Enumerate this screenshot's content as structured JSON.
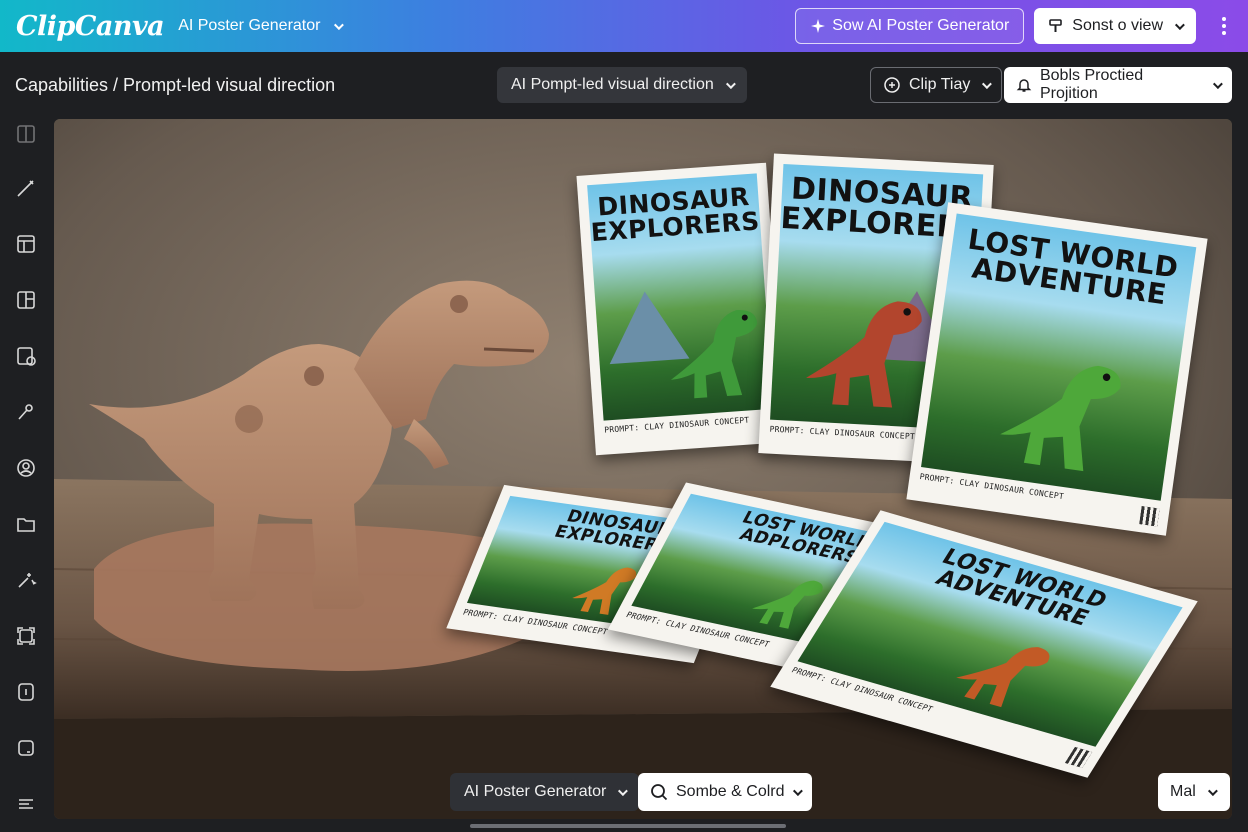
{
  "header": {
    "logo": "ClipCanva",
    "app_menu_label": "AI Poster Generator",
    "primary_button": "Sow AI Poster Generator",
    "view_button": "Sonst o view"
  },
  "subheader": {
    "breadcrumb": "Capabilities / Prompt-led visual direction",
    "mode_dropdown": "AI Pompt-led visual direction",
    "clip_dropdown": "Clip Tiay",
    "projection_dropdown": "Bobls Proctied Projition"
  },
  "sidebar": {
    "icons": [
      "frame-icon",
      "brush-icon",
      "layout-icon",
      "template-icon",
      "upload-icon",
      "pen-tool-icon",
      "user-circle-icon",
      "folder-icon",
      "magic-icon",
      "crop-icon",
      "info-icon",
      "square-icon",
      "sliders-icon"
    ]
  },
  "posters": [
    {
      "title_line1": "DINOSAUR",
      "title_line2": "EXPLORERS",
      "caption": "PROMPT: CLAY DINOSAUR CONCEPT",
      "dino_color": "#3f9a3a"
    },
    {
      "title_line1": "DINOSAUR",
      "title_line2": "EXPLORERS",
      "caption": "PROMPT: CLAY DINOSAUR CONCEPT",
      "dino_color": "#b2452d"
    },
    {
      "title_line1": "LOST WORLD",
      "title_line2": "ADVENTURE",
      "caption": "PROMPT: CLAY DINOSAUR CONCEPT",
      "dino_color": "#4ea83a"
    },
    {
      "title_line1": "DINOSAUR",
      "title_line2": "EXPLORERS",
      "caption": "PROMPT: CLAY DINOSAUR CONCEPT",
      "dino_color": "#d07a25"
    },
    {
      "title_line1": "LOST WORLD",
      "title_line2": "ADPLORERS",
      "caption": "PROMPT: CLAY DINOSAUR CONCEPT",
      "dino_color": "#4ea83a"
    },
    {
      "title_line1": "LOST WORLD",
      "title_line2": "ADVENTURE",
      "caption": "PROMPT: CLAY DINOSAUR CONCEPT",
      "dino_color": "#c25a26"
    }
  ],
  "bottom_toolbar": {
    "generator_dropdown": "AI Poster Generator",
    "search_dropdown": "Sombe & Colrd",
    "mal_dropdown": "Mal"
  },
  "colors": {
    "header_gradient_start": "#12b8c9",
    "header_gradient_end": "#8b4be8",
    "background": "#1e1f22",
    "clay": "#b88a6c"
  }
}
